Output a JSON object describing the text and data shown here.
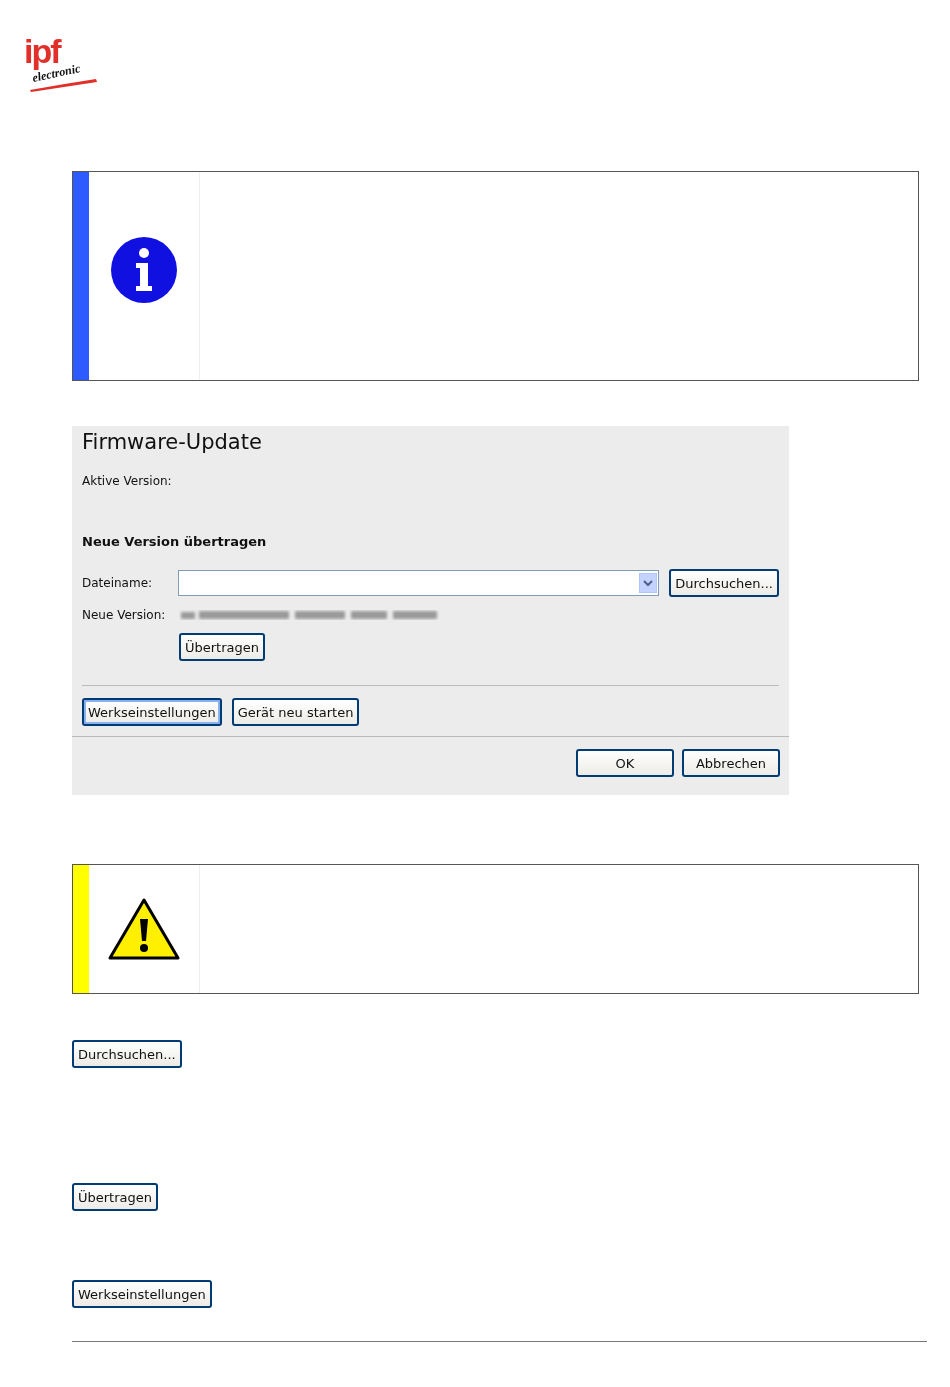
{
  "logo": {
    "brand": "ipf",
    "tagline": "electronic"
  },
  "notices": [
    {
      "kind": "info",
      "color": "#2e5bff"
    },
    {
      "kind": "dialog"
    },
    {
      "kind": "warning",
      "color": "#ffff00"
    }
  ],
  "dialog": {
    "title": "Firmware-Update",
    "active_version_label": "Aktive Version:",
    "section_title": "Neue Version übertragen",
    "file_label": "Dateiname:",
    "browse_button": "Durchsuchen...",
    "new_version_label": "Neue Version:",
    "new_version_value": {
      "kind": "blurred"
    },
    "transfer_button": "Übertragen",
    "action_buttons": [
      {
        "label": "Werkseinstellungen",
        "focused": true
      },
      {
        "label": "Gerät neu starten",
        "focused": false
      }
    ],
    "footer_buttons": [
      "OK",
      "Abbrechen"
    ]
  },
  "reference_buttons": [
    "Durchsuchen...",
    "Übertragen",
    "Werkseinstellungen"
  ]
}
